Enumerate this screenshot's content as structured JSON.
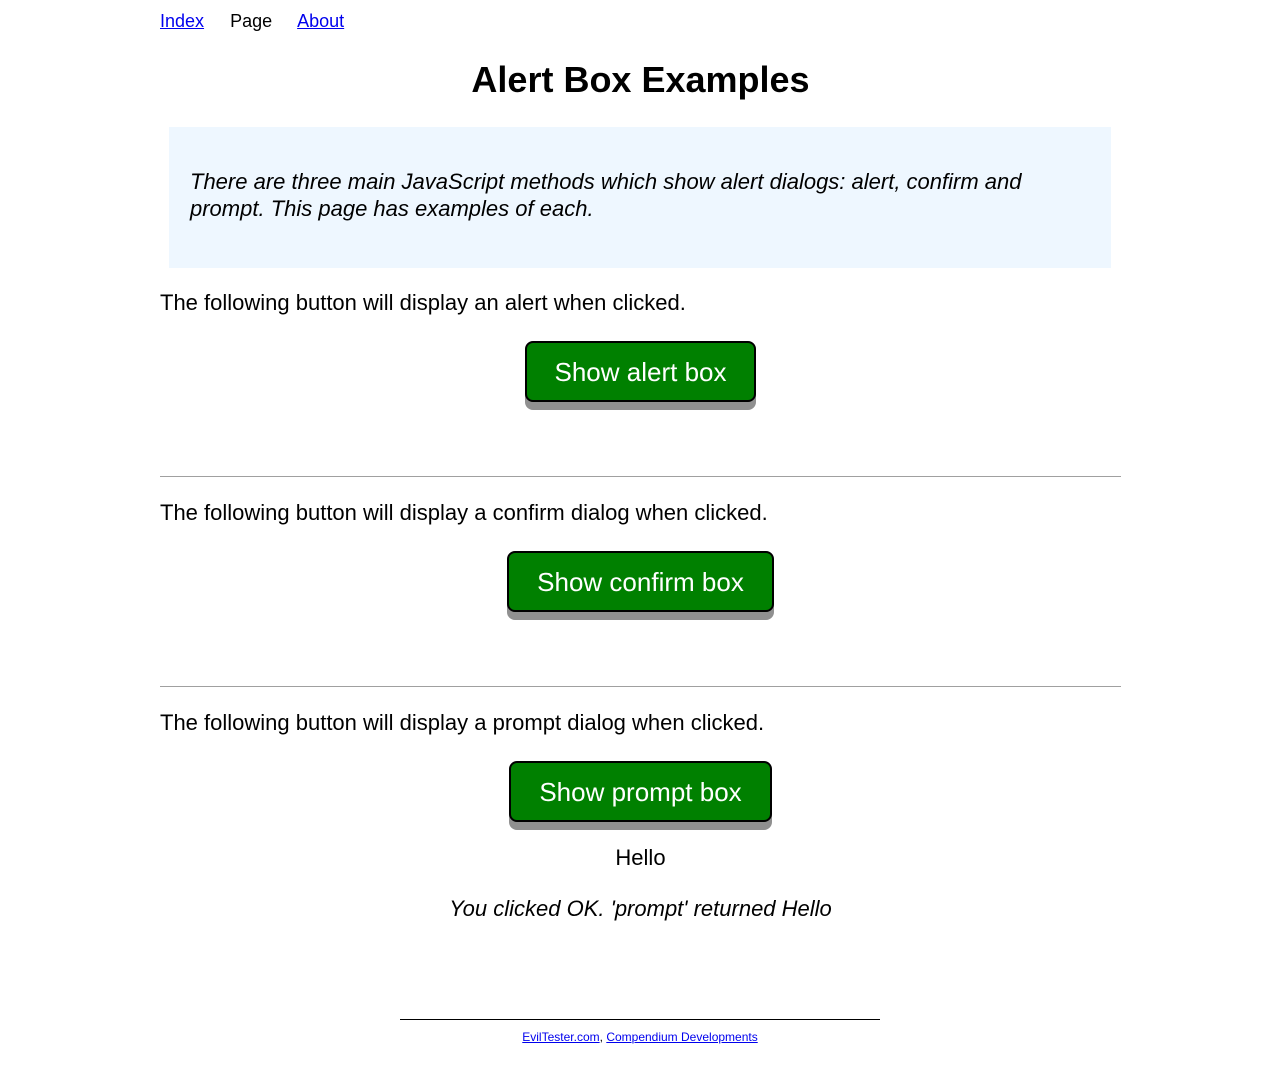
{
  "nav": {
    "index_label": "Index",
    "page_label": "Page",
    "about_label": "About"
  },
  "page_title": "Alert Box Examples",
  "explanation": "There are three main JavaScript methods which show alert dialogs: alert, confirm and prompt. This page has examples of each.",
  "sections": [
    {
      "description": "The following button will display an alert when clicked.",
      "button_label": "Show alert box"
    },
    {
      "description": "The following button will display a confirm dialog when clicked.",
      "button_label": "Show confirm box"
    },
    {
      "description": "The following button will display a prompt dialog when clicked.",
      "button_label": "Show prompt box"
    }
  ],
  "prompt_result": {
    "value": "Hello",
    "explanation": "You clicked OK. 'prompt' returned Hello"
  },
  "footer": {
    "link1": "EvilTester.com",
    "separator": ",",
    "link2": "Compendium Developments"
  },
  "colors": {
    "button_bg": "#008000",
    "explanation_bg": "#eef7ff",
    "link": "#0000ee"
  }
}
